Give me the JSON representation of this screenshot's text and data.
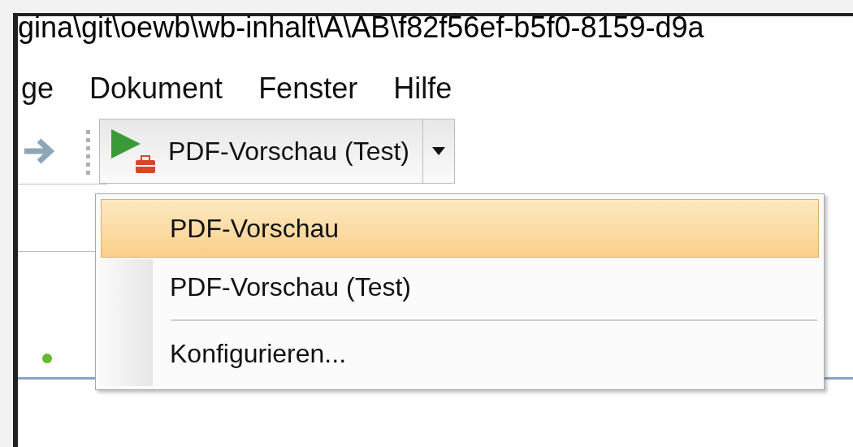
{
  "window": {
    "title": "gina\\git\\oewb\\wb-inhalt\\A\\AB\\f82f56ef-b5f0-8159-d9a"
  },
  "menu_bar": [
    "ge",
    "Dokument",
    "Fenster",
    "Hilfe"
  ],
  "toolbar": {
    "split_button": {
      "label": "PDF-Vorschau (Test)"
    }
  },
  "dropdown": {
    "items": [
      {
        "kind": "item",
        "label": "PDF-Vorschau",
        "selected": true
      },
      {
        "kind": "item",
        "label": "PDF-Vorschau (Test)",
        "selected": false
      },
      {
        "kind": "separator"
      },
      {
        "kind": "item",
        "label": "Konfigurieren...",
        "selected": false
      }
    ]
  }
}
